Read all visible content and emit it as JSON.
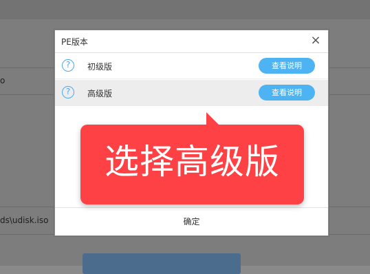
{
  "background": {
    "path_partial_1": "o",
    "path_partial_2": "ds\\udisk.iso"
  },
  "dialog": {
    "title": "PE版本",
    "close_glyph": "×",
    "options": [
      {
        "label": "初级版",
        "button": "查看说明",
        "selected": false
      },
      {
        "label": "高级版",
        "button": "查看说明",
        "selected": true
      }
    ],
    "confirm_label": "确定"
  },
  "annotation": {
    "text": "选择高级版",
    "color": "#fd4145"
  },
  "colors": {
    "accent": "#4db3f2",
    "info_icon": "#4aa8e8"
  }
}
